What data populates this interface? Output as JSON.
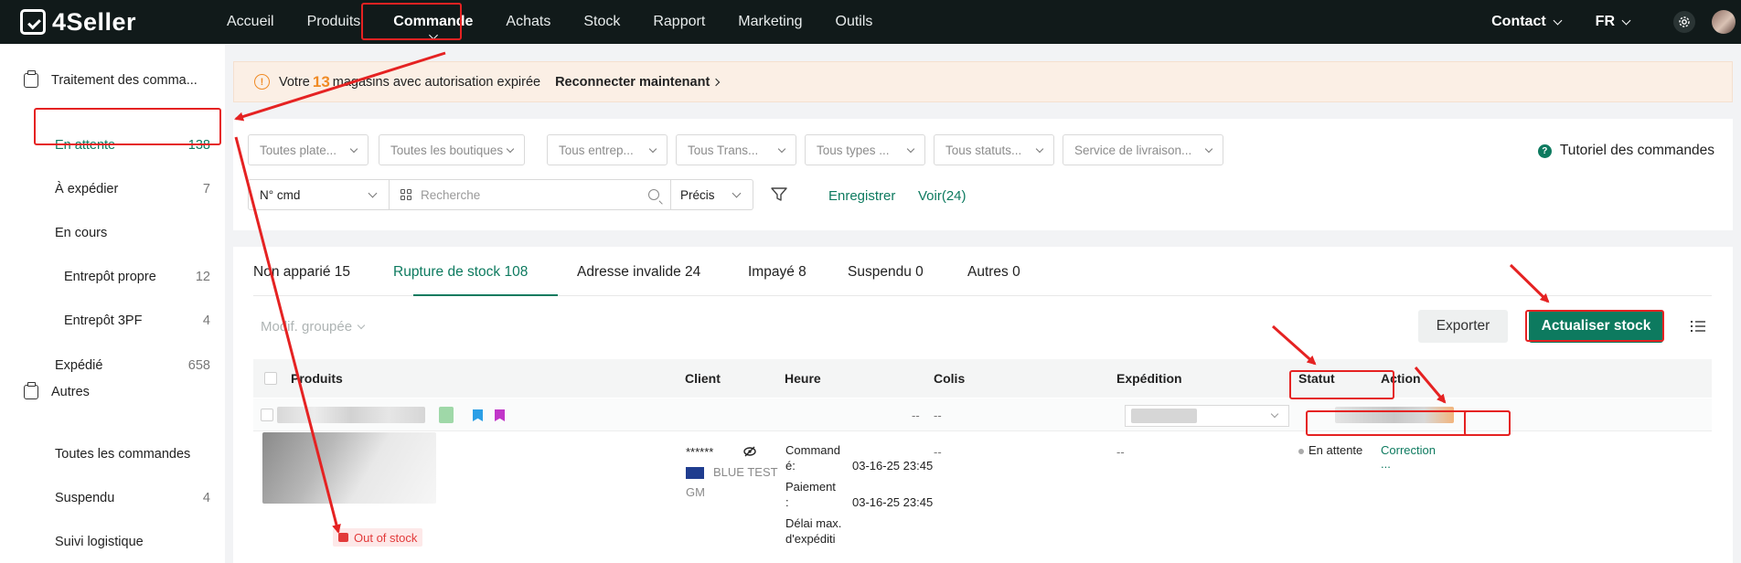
{
  "brand": "4Seller",
  "nav": {
    "items": [
      "Accueil",
      "Produits",
      "Commande",
      "Achats",
      "Stock",
      "Rapport",
      "Marketing",
      "Outils"
    ],
    "active": "Commande",
    "contact": "Contact",
    "lang": "FR"
  },
  "sidebar": {
    "group1": "Traitement des comma...",
    "items": [
      {
        "label": "En attente",
        "count": "138"
      },
      {
        "label": "À expédier",
        "count": "7"
      },
      {
        "label": "En cours",
        "count": ""
      },
      {
        "label": "Entrepôt propre",
        "count": "12"
      },
      {
        "label": "Entrepôt 3PF",
        "count": "4"
      },
      {
        "label": "Expédié",
        "count": "658"
      }
    ],
    "group2": "Autres",
    "items2": [
      {
        "label": "Toutes les commandes",
        "count": ""
      },
      {
        "label": "Suspendu",
        "count": "4"
      },
      {
        "label": "Suivi logistique",
        "count": ""
      }
    ]
  },
  "banner": {
    "prefix": "Votre",
    "number": "13",
    "suffix": "magasins avec autorisation expirée",
    "link": "Reconnecter maintenant"
  },
  "filters": {
    "selects": [
      "Toutes plate...",
      "Toutes les boutiques",
      "Tous entrep...",
      "Tous Trans...",
      "Tous types ...",
      "Tous statuts...",
      "Service de livraison..."
    ],
    "tutorial": "Tutoriel des commandes",
    "search_type": "N° cmd",
    "search_placeholder": "Recherche",
    "precision": "Précis",
    "save": "Enregistrer",
    "view": "Voir(24)"
  },
  "tabs": [
    "Non apparié 15",
    "Rupture de stock 108",
    "Adresse invalide 24",
    "Impayé 8",
    "Suspendu 0",
    "Autres 0"
  ],
  "toolbar": {
    "bulk": "Modif. groupée",
    "export": "Exporter",
    "update": "Actualiser stock"
  },
  "table": {
    "headers": [
      "Produits",
      "Client",
      "Heure",
      "Colis",
      "Expédition",
      "Statut",
      "Action"
    ],
    "row1": {
      "dash1": "--",
      "dash2": "--"
    },
    "row2": {
      "client_masked": "******",
      "client_name": "BLUE TEST",
      "client_name2": "GM",
      "time_label1a": "Command",
      "time_label1b": "é:",
      "time_value1": "03-16-25 23:45",
      "time_label2a": "Paiement",
      "time_label2b": ":",
      "time_value2": "03-16-25 23:45",
      "time_label3a": "Délai max.",
      "time_label3b": "d'expéditi",
      "colis": "--",
      "expedition": "--",
      "status": "En attente",
      "action": "Correction",
      "action_more": "...",
      "out_of_stock": "Out of stock"
    }
  },
  "colors": {
    "accent": "#0d7a5f",
    "topbar": "#111a1a",
    "warning": "#f08a24",
    "annotation": "#e52222"
  }
}
